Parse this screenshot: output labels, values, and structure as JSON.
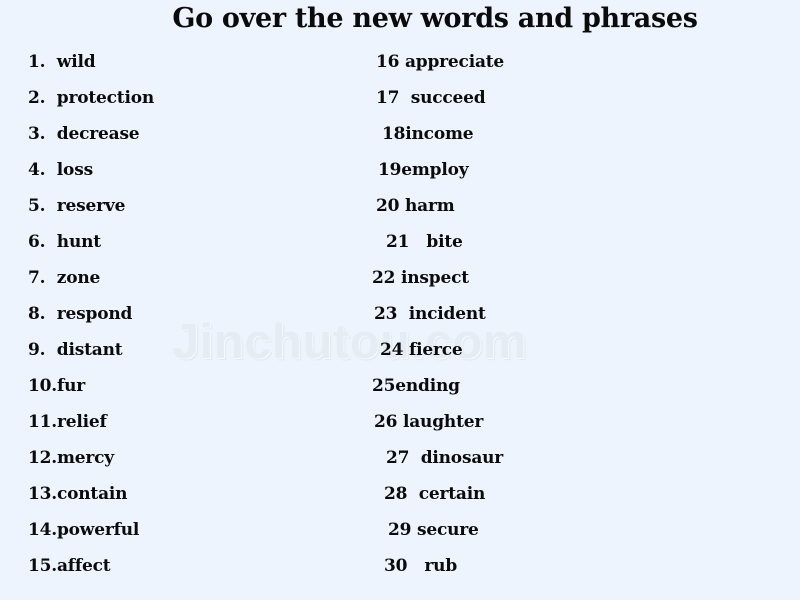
{
  "slide": {
    "title": "Go over the new words and phrases",
    "background_color": "#eef4fd",
    "text_color": "#0b0b0b"
  },
  "watermark": {
    "text": "Jinchutou.com",
    "color": "#e6ecf4"
  },
  "left_column": [
    {
      "number": "1.",
      "gap": "  ",
      "word": "wild",
      "indent": 0
    },
    {
      "number": "2.",
      "gap": "  ",
      "word": "protection",
      "indent": 0
    },
    {
      "number": "3.",
      "gap": "  ",
      "word": "decrease",
      "indent": 0
    },
    {
      "number": "4.",
      "gap": "  ",
      "word": "loss",
      "indent": 0
    },
    {
      "number": "5.",
      "gap": "  ",
      "word": "reserve",
      "indent": 0
    },
    {
      "number": "6.",
      "gap": "  ",
      "word": "hunt",
      "indent": 0
    },
    {
      "number": "7.",
      "gap": "  ",
      "word": "zone",
      "indent": 0
    },
    {
      "number": "8.",
      "gap": "  ",
      "word": "respond",
      "indent": 0
    },
    {
      "number": "9.",
      "gap": "  ",
      "word": "distant",
      "indent": 0
    },
    {
      "number": "10.",
      "gap": "",
      "word": "fur",
      "indent": 0
    },
    {
      "number": "11.",
      "gap": "",
      "word": "relief",
      "indent": 0
    },
    {
      "number": "12.",
      "gap": "",
      "word": "mercy",
      "indent": 0
    },
    {
      "number": "13.",
      "gap": "",
      "word": "contain",
      "indent": 0
    },
    {
      "number": "14.",
      "gap": "",
      "word": "powerful",
      "indent": 0
    },
    {
      "number": "15.",
      "gap": "",
      "word": "affect",
      "indent": 0
    }
  ],
  "right_column": [
    {
      "number": "16",
      "gap": " ",
      "word": "appreciate",
      "indent": 4
    },
    {
      "number": "17",
      "gap": "  ",
      "word": "succeed",
      "indent": 4
    },
    {
      "number": "18",
      "gap": "",
      "word": "income",
      "indent": 10
    },
    {
      "number": "19",
      "gap": "",
      "word": "employ",
      "indent": 6
    },
    {
      "number": "20",
      "gap": " ",
      "word": "harm",
      "indent": 4
    },
    {
      "number": "21",
      "gap": "   ",
      "word": "bite",
      "indent": 14
    },
    {
      "number": "22",
      "gap": " ",
      "word": "inspect",
      "indent": 0
    },
    {
      "number": "23",
      "gap": "  ",
      "word": "incident",
      "indent": 2
    },
    {
      "number": "24",
      "gap": " ",
      "word": "fierce",
      "indent": 8
    },
    {
      "number": "25",
      "gap": "",
      "word": "ending",
      "indent": 0
    },
    {
      "number": "26",
      "gap": " ",
      "word": "laughter",
      "indent": 2
    },
    {
      "number": "27",
      "gap": "  ",
      "word": "dinosaur",
      "indent": 14
    },
    {
      "number": "28",
      "gap": "  ",
      "word": "certain",
      "indent": 12
    },
    {
      "number": "29",
      "gap": " ",
      "word": "secure",
      "indent": 16
    },
    {
      "number": "30",
      "gap": "   ",
      "word": "rub",
      "indent": 12
    }
  ]
}
